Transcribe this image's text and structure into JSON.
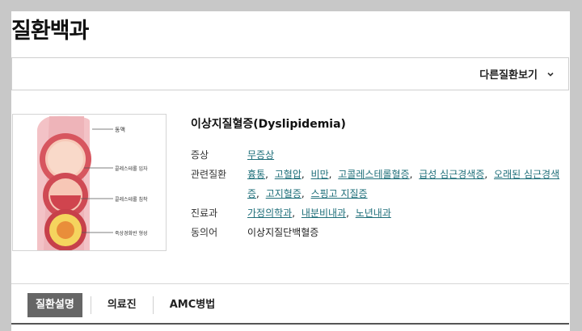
{
  "header": {
    "title": "질환백과"
  },
  "other_diseases": {
    "label": "다른질환보기",
    "icon": "chevron-down-icon"
  },
  "figure": {
    "labels": [
      "동맥",
      "콜레스테롤 입자",
      "콜레스테롤 침착",
      "죽상경화반 형성"
    ]
  },
  "disease": {
    "title": "이상지질혈증(Dyslipidemia)",
    "symptom_label": "증상",
    "symptoms": [
      "무증상"
    ],
    "related_label": "관련질환",
    "related": [
      "흉통",
      "고혈압",
      "비만",
      "고콜레스테롤혈증",
      "급성 심근경색증",
      "오래된 심근경색증",
      "고지혈증",
      "스핑고 지질증"
    ],
    "dept_label": "진료과",
    "departments": [
      "가정의학과",
      "내분비내과",
      "노년내과"
    ],
    "synonym_label": "동의어",
    "synonym": "이상지질단백혈증"
  },
  "tabs": [
    {
      "label": "질환설명",
      "active": true
    },
    {
      "label": "의료진",
      "active": false
    },
    {
      "label": "AMC병법",
      "active": false
    }
  ],
  "colors": {
    "link": "#1f6f7a",
    "active_tab": "#666666"
  }
}
